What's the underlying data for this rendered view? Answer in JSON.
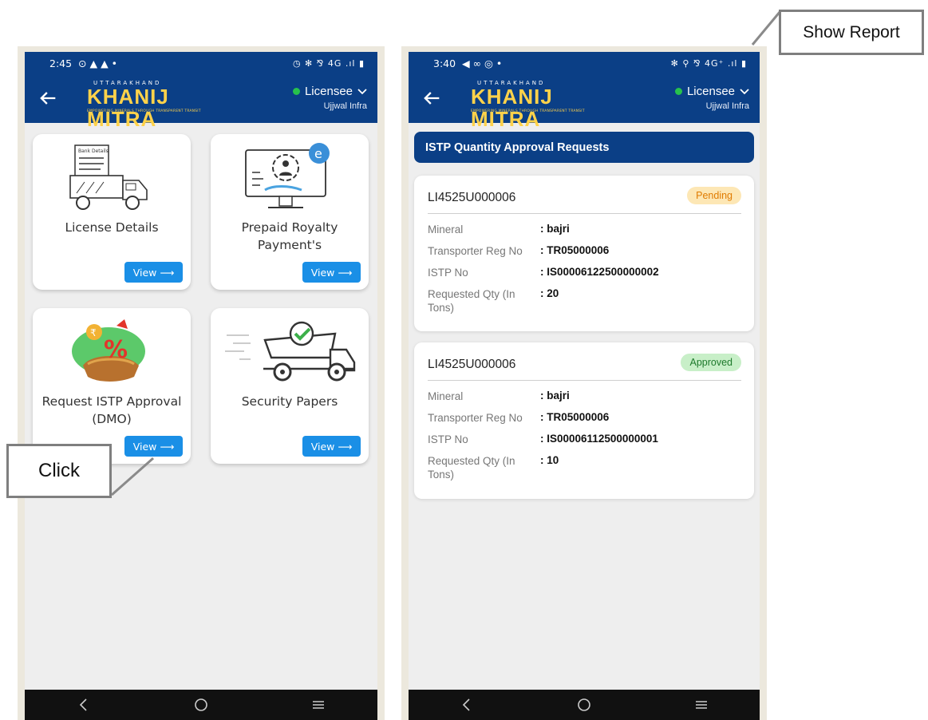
{
  "phone1": {
    "status": {
      "time": "2:45",
      "left_icons": "⊙ ▲ ▲ •",
      "right_icons": "◷ ✻ ⅋ 4G .ıl ▮"
    },
    "appbar": {
      "logo_top": "UTTARAKHAND",
      "logo_main": "KHANIJ MITRA",
      "logo_tag": "EMPOWERING MINERALS THROUGH TRANSPARENT TRANSIT",
      "role": "Licensee",
      "org": "Ujjwal Infra"
    },
    "tiles": [
      {
        "title": "License Details",
        "button": "View"
      },
      {
        "title": "Prepaid Royalty Payment's",
        "button": "View"
      },
      {
        "title": "Request ISTP Approval (DMO)",
        "button": "View"
      },
      {
        "title": "Security Papers",
        "button": "View"
      }
    ],
    "tile_icon_caption": "Bank Details"
  },
  "phone2": {
    "status": {
      "time": "3:40",
      "left_icons": "◀ ∞ ◎ •",
      "right_icons": "✻ ⚲ ⅋ 4G⁺ .ıl ▮"
    },
    "appbar": {
      "logo_top": "UTTARAKHAND",
      "logo_main": "KHANIJ MITRA",
      "logo_tag": "EMPOWERING MINERALS THROUGH TRANSPARENT TRANSIT",
      "role": "Licensee",
      "org": "Ujjwal Infra"
    },
    "section_title": "ISTP Quantity Approval Requests",
    "requests": [
      {
        "id": "LI4525U000006",
        "status": "Pending",
        "mineral_label": "Mineral",
        "mineral": ": bajri",
        "reg_label": "Transporter Reg No",
        "reg": ": TR05000006",
        "istp_label": "ISTP No",
        "istp": ": IS00006122500000002",
        "qty_label": "Requested Qty (In Tons)",
        "qty": ": 20"
      },
      {
        "id": "LI4525U000006",
        "status": "Approved",
        "mineral_label": "Mineral",
        "mineral": ": bajri",
        "reg_label": "Transporter Reg No",
        "reg": ": TR05000006",
        "istp_label": "ISTP No",
        "istp": ": IS00006112500000001",
        "qty_label": "Requested Qty (In Tons)",
        "qty": ": 10"
      }
    ]
  },
  "callouts": {
    "click": "Click",
    "report": "Show Report"
  },
  "colors": {
    "appbar": "#0b3f86",
    "button": "#1a8fe6",
    "pending_bg": "#fde7b5",
    "approved_bg": "#c8efc8"
  }
}
